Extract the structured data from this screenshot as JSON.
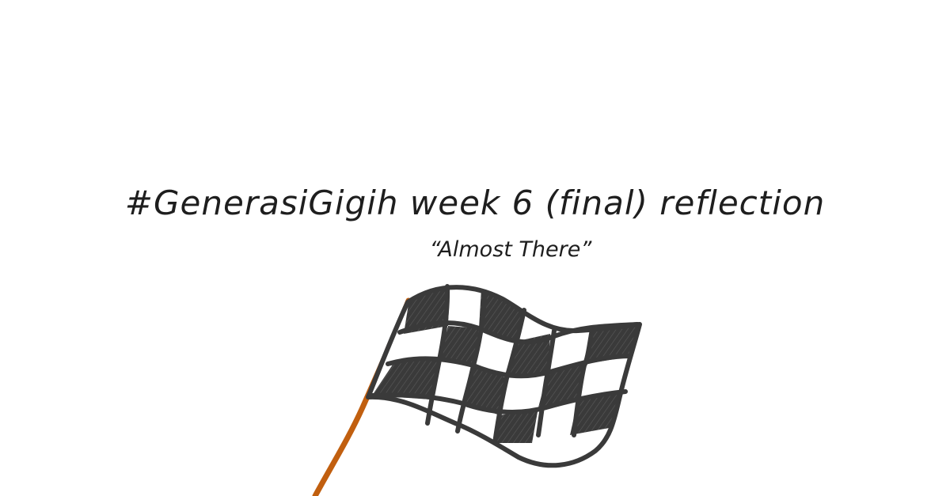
{
  "title": "#GenerasiGigih week 6 (final) reflection",
  "subtitle": "“Almost There”",
  "illustration": {
    "icon": "checkered-flag-icon",
    "pole_color": "#c15f0f",
    "ink_color": "#3a3a3a"
  }
}
